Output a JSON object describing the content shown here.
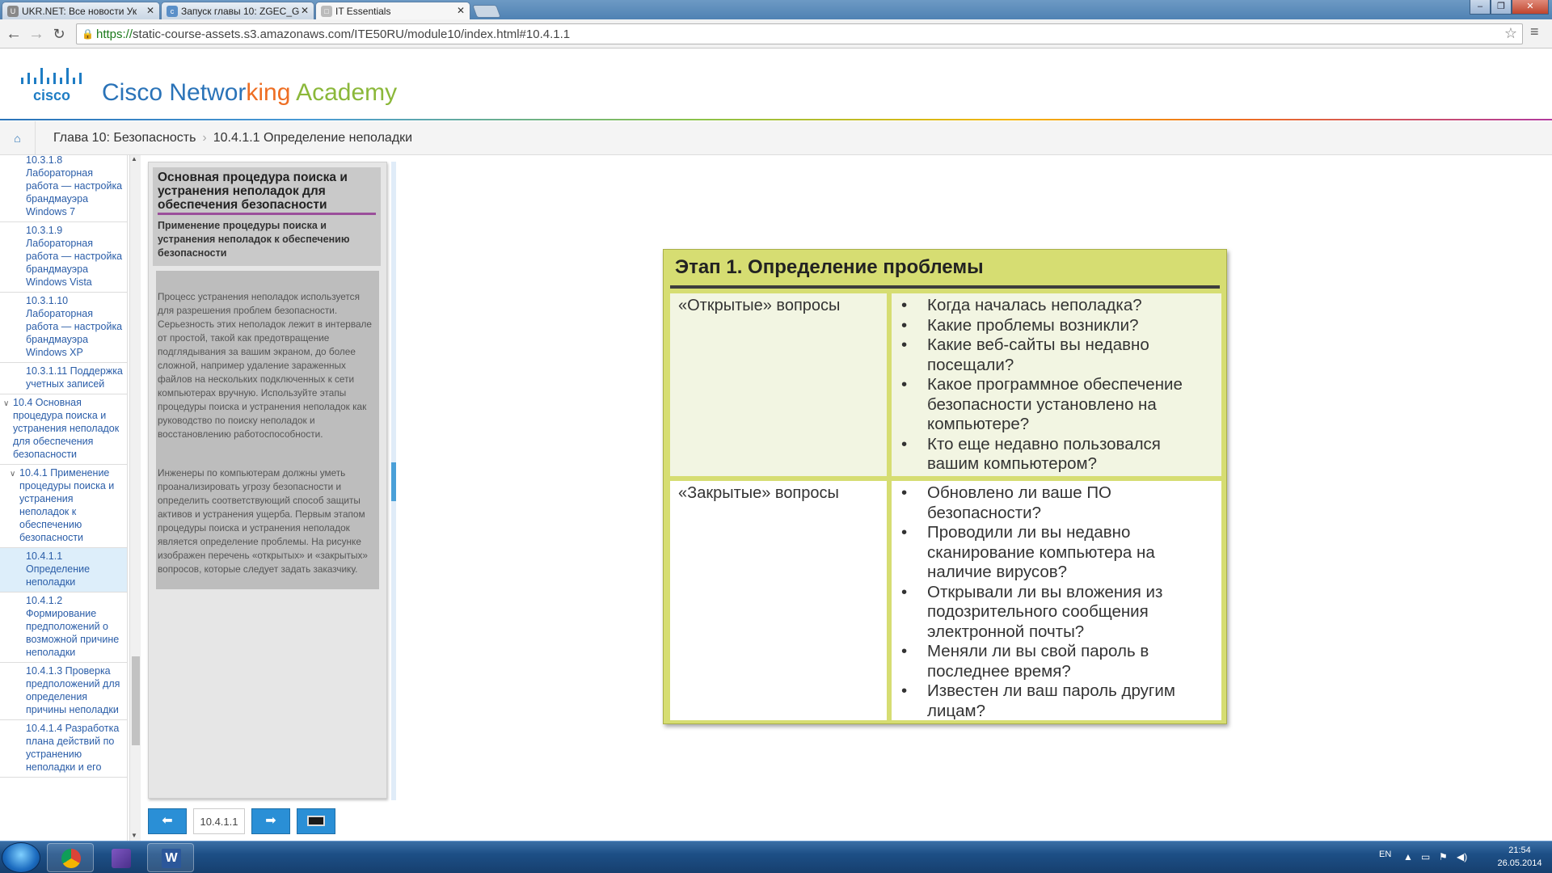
{
  "browser": {
    "tabs": [
      {
        "title": "UKR.NET: Все новости Ук",
        "fav_color": "#888"
      },
      {
        "title": "Запуск главы 10: ZGEC_G",
        "fav_color": "#5a8fc8"
      },
      {
        "title": "IT Essentials",
        "fav_color": "#bbb"
      }
    ],
    "url_scheme": "https://",
    "url_rest": "static-course-assets.s3.amazonaws.com/ITE50RU/module10/index.html#10.4.1.1"
  },
  "header": {
    "logo_text": "cisco",
    "brand": {
      "part1": "Cisco Networ",
      "part2": "king",
      "part3": " Academy"
    }
  },
  "breadcrumb": {
    "chapter": "Глава 10: Безопасность",
    "topic": "10.4.1.1 Определение неполадки"
  },
  "sidebar": {
    "items": [
      {
        "label": "10.3.1.8 Лабораторная работа — настройка брандмауэра Windows 7",
        "level": 3,
        "selected": false
      },
      {
        "label": "10.3.1.9 Лабораторная работа — настройка брандмауэра Windows Vista",
        "level": 3,
        "selected": false
      },
      {
        "label": "10.3.1.10 Лабораторная работа — настройка брандмауэра Windows XP",
        "level": 3,
        "selected": false
      },
      {
        "label": "10.3.1.11 Поддержка учетных записей",
        "level": 3,
        "selected": false
      },
      {
        "label": "10.4 Основная процедура поиска и устранения неполадок для обеспечения безопасности",
        "level": 1,
        "selected": false
      },
      {
        "label": "10.4.1 Применение процедуры поиска и устранения неполадок к обеспечению безопасности",
        "level": 2,
        "selected": false
      },
      {
        "label": "10.4.1.1 Определение неполадки",
        "level": 3,
        "selected": true
      },
      {
        "label": "10.4.1.2 Формирование предположений о возможной причине неполадки",
        "level": 3,
        "selected": false
      },
      {
        "label": "10.4.1.3 Проверка предположений для определения причины неполадки",
        "level": 3,
        "selected": false
      },
      {
        "label": "10.4.1.4 Разработка плана действий по устранению неполадки и его",
        "level": 3,
        "selected": false
      }
    ]
  },
  "panel": {
    "title": "Основная процедура поиска и устранения неполадок для обеспечения безопасности",
    "subtitle": "Применение процедуры поиска и устранения неполадок к обеспечению безопасности",
    "paragraph1": "Процесс устранения неполадок используется для разрешения проблем безопасности. Серьезность этих неполадок лежит в интервале от простой, такой как предотвращение подглядывания за вашим экраном, до более сложной, например удаление зараженных файлов на нескольких подключенных к сети компьютерах вручную. Используйте этапы процедуры поиска и устранения неполадок как руководство по поиску неполадок и восстановлению работоспособности.",
    "paragraph2": "Инженеры по компьютерам должны уметь проанализировать угрозу безопасности и определить соответствующий способ защиты активов и устранения ущерба. Первым этапом процедуры поиска и устранения неполадок является определение проблемы. На рисунке изображен перечень «открытых» и «закрытых» вопросов, которые следует задать заказчику."
  },
  "controls": {
    "prev_icon": "arrow-left-icon",
    "page": "10.4.1.1",
    "next_icon": "arrow-right-icon",
    "fullscreen_icon": "screen-icon"
  },
  "figure": {
    "title": "Этап 1. Определение проблемы",
    "open_label": "«Открытые» вопросы",
    "open_questions": [
      "Когда началась неполадка?",
      "Какие проблемы возникли?",
      "Какие веб-сайты вы недавно посещали?",
      "Какое программное обеспечение безопасности установлено на компьютере?",
      "Кто еще недавно пользовался вашим компьютером?"
    ],
    "closed_label": "«Закрытые» вопросы",
    "closed_questions": [
      "Обновлено ли ваше ПО безопасности?",
      "Проводили ли вы недавно сканирование компьютера на наличие вирусов?",
      "Открывали ли вы вложения из подозрительного сообщения электронной почты?",
      "Меняли ли вы свой пароль в последнее время?",
      "Известен ли ваш пароль другим лицам?"
    ]
  },
  "taskbar": {
    "lang": "EN",
    "time": "21:54",
    "date": "26.05.2014"
  },
  "colors": {
    "accent": "#2a8fd6",
    "figure_bg": "#d6dd72",
    "brand_blue": "#2a73b8"
  }
}
